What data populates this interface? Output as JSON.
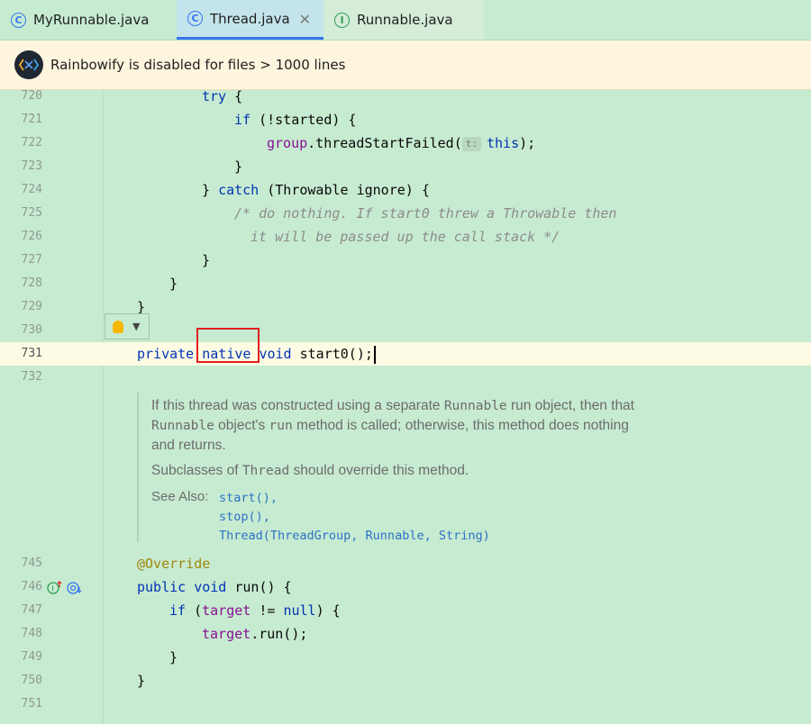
{
  "tabs": [
    {
      "label": "MyRunnable.java",
      "icon": "C"
    },
    {
      "label": "Thread.java",
      "icon": "C"
    },
    {
      "label": "Runnable.java",
      "icon": "I"
    }
  ],
  "banner": {
    "message": "Rainbowify is disabled for files > 1000 lines"
  },
  "lines": {
    "l720": "720",
    "l721": "721",
    "l722": "722",
    "l723": "723",
    "l724": "724",
    "l725": "725",
    "l726": "726",
    "l727": "727",
    "l728": "728",
    "l729": "729",
    "l730": "730",
    "l731": "731",
    "l732": "732",
    "l745": "745",
    "l746": "746",
    "l747": "747",
    "l748": "748",
    "l749": "749",
    "l750": "750",
    "l751": "751"
  },
  "code": {
    "try": "try",
    "brace_open": " {",
    "if": "if",
    "not_started": " (!started) {",
    "group": "group",
    "thread_start_failed": ".threadStartFailed(",
    "hint_t": "t:",
    "this": "this",
    "close_paren_semi": ");",
    "brace_close": "}",
    "catch": "catch",
    "catch_rest": " (Throwable ignore) {",
    "comment1": "/* do nothing. If start0 threw a Throwable then",
    "comment2": "it will be passed up the call stack */",
    "private": "private",
    "native": "native",
    "void": "void",
    "start0": " start0();",
    "override": "@Override",
    "public": "public",
    "run_sig": " run() {",
    "target": "target",
    "neq": " != ",
    "null": "null",
    "if_close": ") {",
    "run_call": ".run();",
    "paren_open": " ("
  },
  "doc": {
    "p1_a": "If this thread was constructed using a separate ",
    "p1_runnable": "Runnable",
    "p1_b": " run object, then that",
    "p1_runnable2": "Runnable",
    "p1_c": " object's ",
    "p1_run": "run",
    "p1_d": " method is called; otherwise, this method does nothing",
    "p1_e": "and returns.",
    "p2_a": "Subclasses of ",
    "p2_thread": "Thread",
    "p2_b": " should override this method.",
    "see_also_label": "See Also:",
    "links": [
      "start(),",
      "stop(),",
      "Thread(ThreadGroup, Runnable, String)"
    ]
  },
  "colors": {
    "keyword": "#0033b3",
    "field": "#871094",
    "annotation": "#9e880d",
    "link": "#2c72c6",
    "highlight_box": "#e02020"
  }
}
